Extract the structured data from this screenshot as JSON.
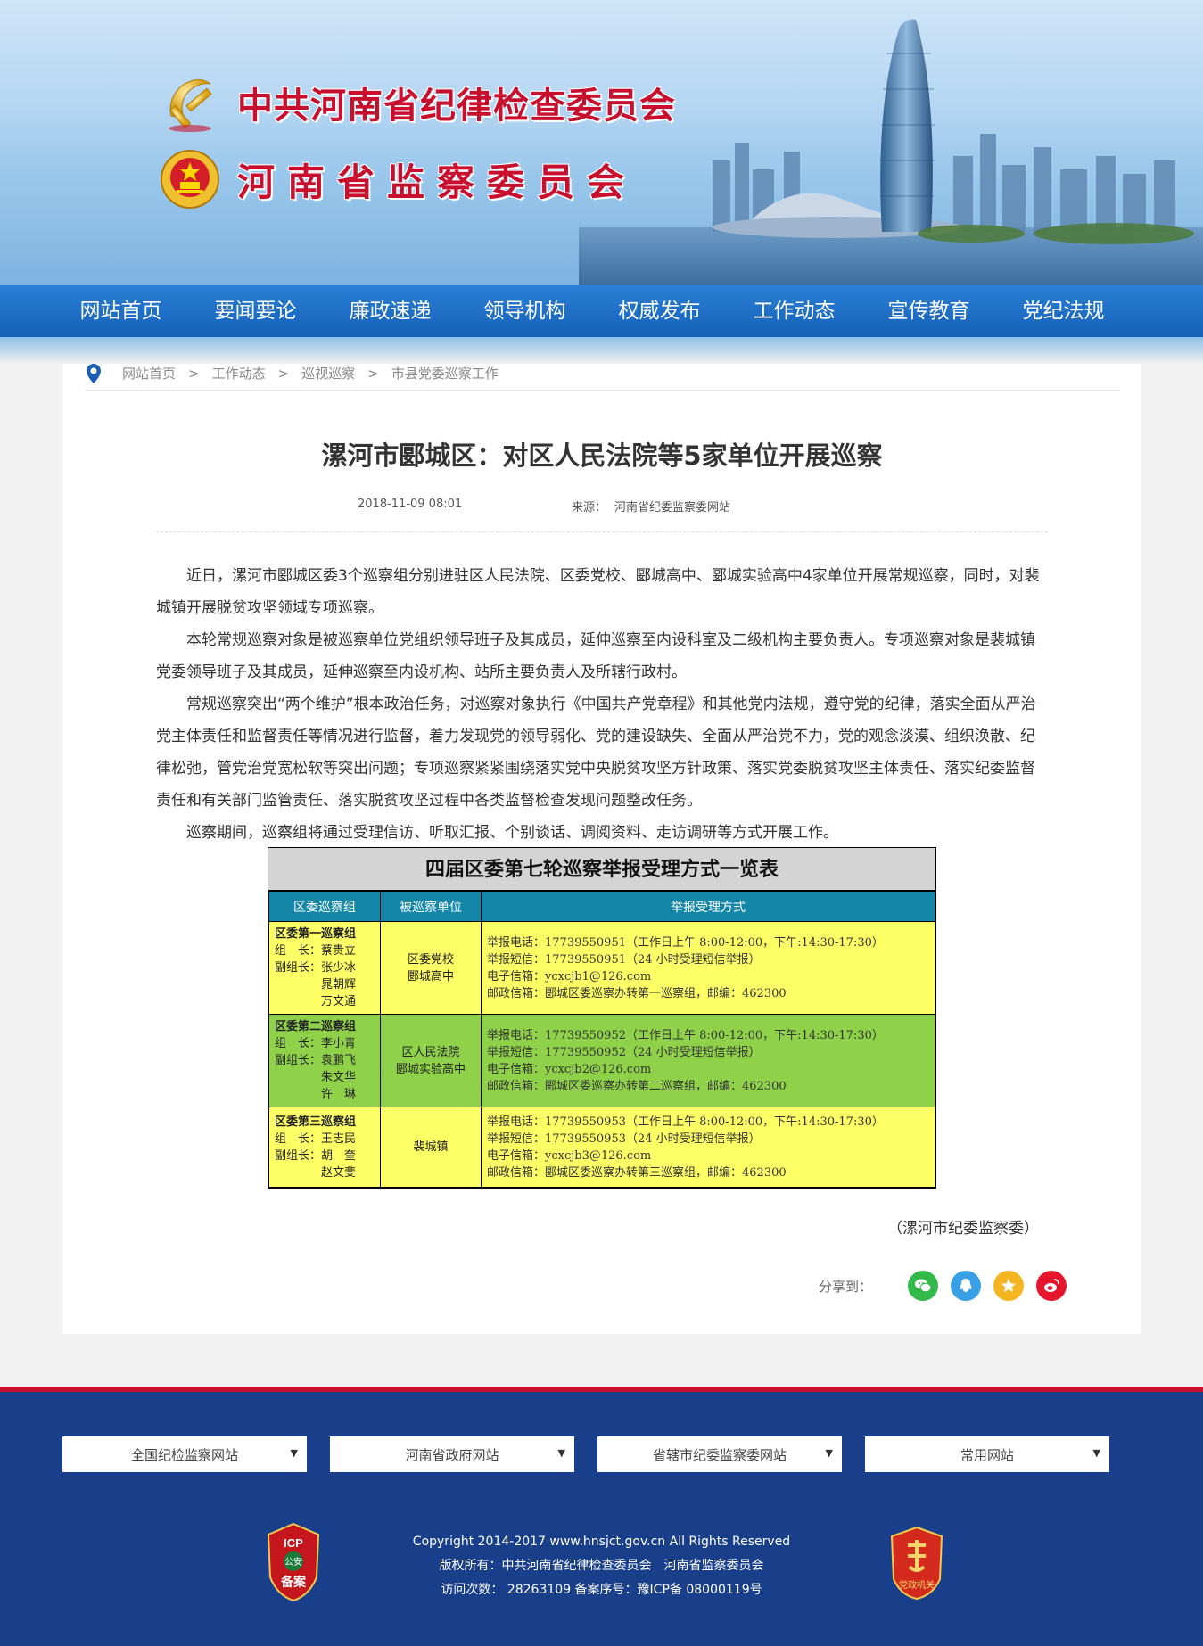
{
  "header": {
    "title_line1": "中共河南省纪律检查委员会",
    "title_line2": "河南省监察委员会"
  },
  "nav": {
    "items": [
      "网站首页",
      "要闻要论",
      "廉政速递",
      "领导机构",
      "权威发布",
      "工作动态",
      "宣传教育",
      "党纪法规"
    ]
  },
  "breadcrumb": {
    "items": [
      "网站首页",
      "工作动态",
      "巡视巡察",
      "市县党委巡察工作"
    ],
    "separator": ">"
  },
  "article": {
    "title": "漯河市郾城区：对区人民法院等5家单位开展巡察",
    "date": "2018-11-09 08:01",
    "source_label": "来源：",
    "source": "河南省纪委监察委网站",
    "paragraphs": [
      "近日，漯河市郾城区委3个巡察组分别进驻区人民法院、区委党校、郾城高中、郾城实验高中4家单位开展常规巡察，同时，对裴城镇开展脱贫攻坚领域专项巡察。",
      "本轮常规巡察对象是被巡察单位党组织领导班子及其成员，延伸巡察至内设科室及二级机构主要负责人。专项巡察对象是裴城镇党委领导班子及其成员，延伸巡察至内设机构、站所主要负责人及所辖行政村。",
      "常规巡察突出“两个维护”根本政治任务，对巡察对象执行《中国共产党章程》和其他党内法规，遵守党的纪律，落实全面从严治党主体责任和监督责任等情况进行监督，着力发现党的领导弱化、党的建设缺失、全面从严治党不力，党的观念淡漠、组织涣散、纪律松弛，管党治党宽松软等突出问题；专项巡察紧紧围绕落实党中央脱贫攻坚方针政策、落实党委脱贫攻坚主体责任、落实纪委监督责任和有关部门监管责任、落实脱贫攻坚过程中各类监督检查发现问题整改任务。",
      "巡察期间，巡察组将通过受理信访、听取汇报、个别谈话、调阅资料、走访调研等方式开展工作。"
    ],
    "credit": "（漯河市纪委监察委）"
  },
  "report_table": {
    "caption": "四届区委第七轮巡察举报受理方式一览表",
    "headers": [
      "区委巡察组",
      "被巡察单位",
      "举报受理方式"
    ],
    "rows": [
      {
        "group": "区委第一巡察组",
        "members": [
          "组　长：蔡贵立",
          "副组长：张少冰",
          "　　　　晁朝辉",
          "　　　　万文通"
        ],
        "units": [
          "区委党校",
          "郾城高中"
        ],
        "ways": [
          "举报电话：17739550951（工作日上午 8:00-12:00，下午:14:30-17:30）",
          "举报短信：17739550951（24 小时受理短信举报）",
          "电子信箱：ycxcjb1@126.com",
          "邮政信箱：郾城区委巡察办转第一巡察组，邮编：462300"
        ],
        "color": "#ffff66"
      },
      {
        "group": "区委第二巡察组",
        "members": [
          "组　长：李小青",
          "副组长：袁鹏飞",
          "　　　　朱文华",
          "　　　　许　琳"
        ],
        "units": [
          "区人民法院",
          "郾城实验高中"
        ],
        "ways": [
          "举报电话：17739550952（工作日上午 8:00-12:00，下午:14:30-17:30）",
          "举报短信：17739550952（24 小时受理短信举报）",
          "电子信箱：ycxcjb2@126.com",
          "邮政信箱：郾城区委巡察办转第二巡察组，邮编：462300"
        ],
        "color": "#8fd24a"
      },
      {
        "group": "区委第三巡察组",
        "members": [
          "组　长：王志民",
          "副组长：胡　奎",
          "　　　　赵文斐"
        ],
        "units": [
          "裴城镇"
        ],
        "ways": [
          "举报电话：17739550953（工作日上午 8:00-12:00，下午:14:30-17:30）",
          "举报短信：17739550953（24 小时受理短信举报）",
          "电子信箱：ycxcjb3@126.com",
          "邮政信箱：郾城区委巡察办转第三巡察组，邮编：462300"
        ],
        "color": "#ffff66"
      }
    ]
  },
  "share": {
    "label": "分享到：",
    "buttons": [
      {
        "name": "wechat",
        "color": "#33b94a"
      },
      {
        "name": "qq",
        "color": "#3aa0e6"
      },
      {
        "name": "qzone",
        "color": "#f4b521"
      },
      {
        "name": "weibo",
        "color": "#e6162d"
      }
    ]
  },
  "footer": {
    "selects": [
      "全国纪检监察网站",
      "河南省政府网站",
      "省辖市纪委监察委网站",
      "常用网站"
    ],
    "copyright": "Copyright 2014-2017 www.hnsjct.gov.cn All Rights Reserved",
    "owner": "版权所有：中共河南省纪律检查委员会　河南省监察委员会",
    "visits": "访问次数：  28263109   备案序号：豫ICP备 08000119号",
    "badge_left_top": "ICP",
    "badge_left_mid": "公安",
    "badge_left_bottom": "备案",
    "badge_right_text": "党政机关"
  }
}
